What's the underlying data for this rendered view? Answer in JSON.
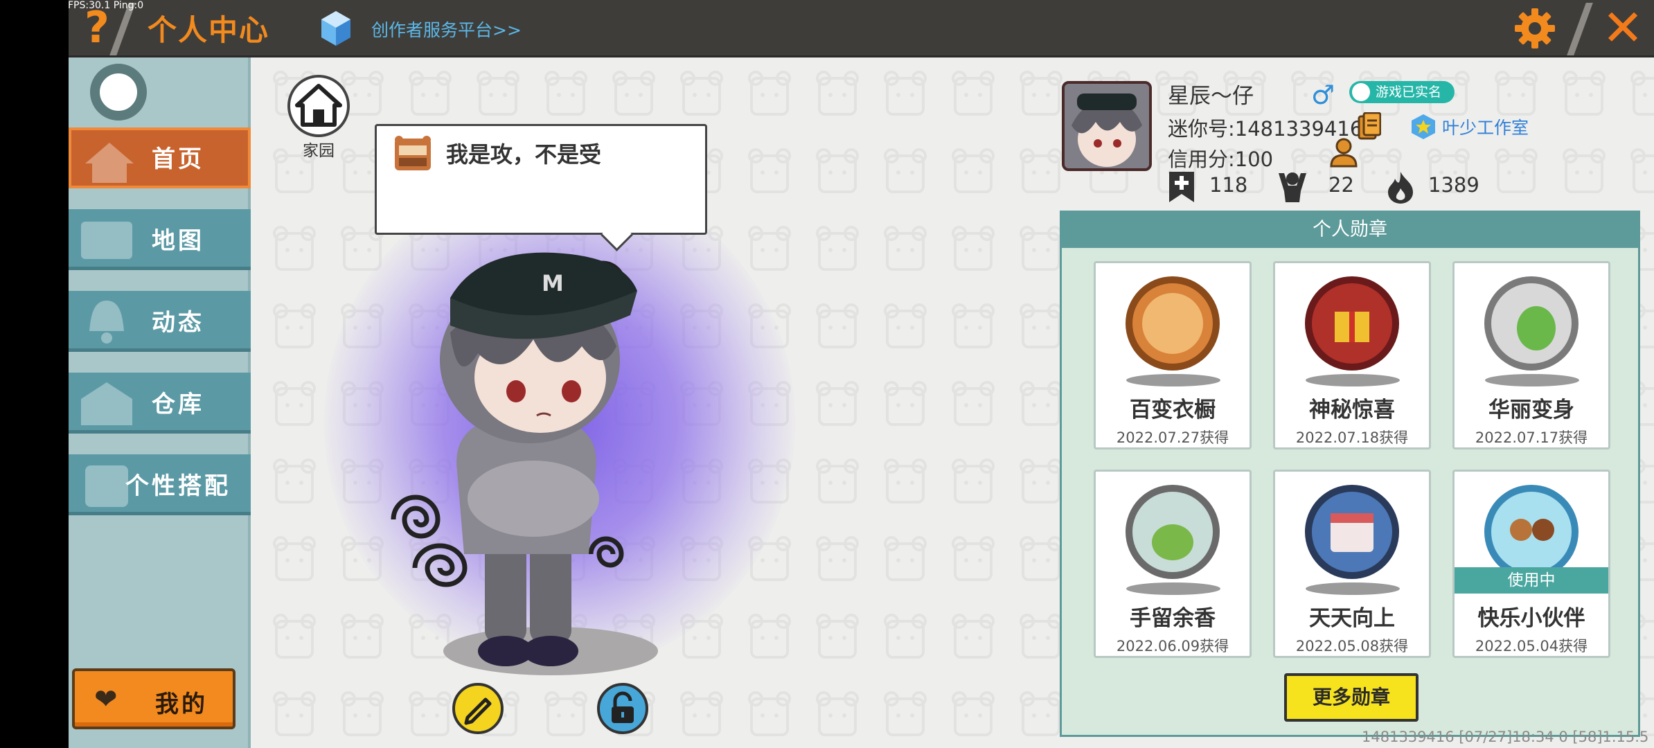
{
  "debug": {
    "fps_ping": "FPS:30.1  Ping:0"
  },
  "header": {
    "help": "?",
    "title": "个人中心",
    "creator_link": "创作者服务平台>>",
    "close": "✕"
  },
  "sidebar": {
    "items": [
      {
        "label": "首页",
        "icon": "home-icon"
      },
      {
        "label": "地图",
        "icon": "map-icon"
      },
      {
        "label": "动态",
        "icon": "bell-icon"
      },
      {
        "label": "仓库",
        "icon": "warehouse-icon"
      },
      {
        "label": "个性搭配",
        "icon": "outfit-icon"
      }
    ],
    "mine_label": "我的",
    "mine_icon": "❤"
  },
  "stage": {
    "home_label": "家园",
    "signature": "我是攻，不是受"
  },
  "profile": {
    "nickname": "星辰～仔",
    "gender_symbol": "♂",
    "verified_label": "游戏已实名",
    "mini_id": "迷你号:1481339416",
    "studio": "叶少工作室",
    "credit": "信用分:100",
    "stats": [
      {
        "icon": "bookmark-plus-icon",
        "value": "118"
      },
      {
        "icon": "fans-icon",
        "value": "22"
      },
      {
        "icon": "flame-icon",
        "value": "1389"
      }
    ]
  },
  "medals": {
    "title": "个人勋章",
    "items": [
      {
        "name": "百变衣橱",
        "date": "2022.07.27获得",
        "color": "#d9823a",
        "in_use": false
      },
      {
        "name": "神秘惊喜",
        "date": "2022.07.18获得",
        "color": "#b0302a",
        "in_use": false
      },
      {
        "name": "华丽变身",
        "date": "2022.07.17获得",
        "color": "#b8b8b8",
        "in_use": false
      },
      {
        "name": "手留余香",
        "date": "2022.06.09获得",
        "color": "#9a9a9a",
        "in_use": false
      },
      {
        "name": "天天向上",
        "date": "2022.05.08获得",
        "color": "#4c78b8",
        "in_use": false
      },
      {
        "name": "快乐小伙伴",
        "date": "2022.05.04获得",
        "color": "#6fc8e8",
        "in_use": true
      }
    ],
    "in_use_label": "使用中",
    "more_label": "更多勋章"
  },
  "footer": {
    "info": "1481339416    [07/27]18:34 0   [58]1.15.5"
  }
}
